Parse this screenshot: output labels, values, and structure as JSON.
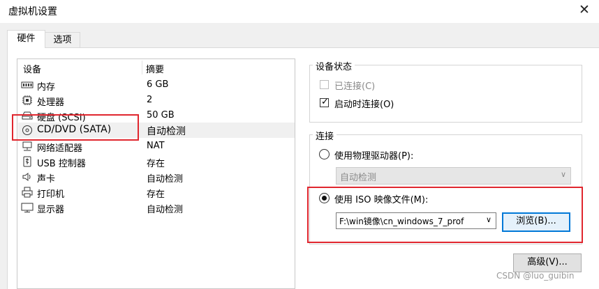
{
  "window": {
    "title": "虚拟机设置",
    "close_glyph": "✕"
  },
  "tabs": [
    {
      "label": "硬件"
    },
    {
      "label": "选项"
    }
  ],
  "device_list": {
    "col_device": "设备",
    "col_summary": "摘要",
    "rows": [
      {
        "name": "内存",
        "summary": "6 GB",
        "icon": "memory-icon"
      },
      {
        "name": "处理器",
        "summary": "2",
        "icon": "processor-icon"
      },
      {
        "name": "硬盘 (SCSI)",
        "summary": "50 GB",
        "icon": "hard-disk-icon"
      },
      {
        "name": "CD/DVD (SATA)",
        "summary": "自动检测",
        "icon": "cd-dvd-icon",
        "selected": true
      },
      {
        "name": "网络适配器",
        "summary": "NAT",
        "icon": "network-adapter-icon"
      },
      {
        "name": "USB 控制器",
        "summary": "存在",
        "icon": "usb-icon"
      },
      {
        "name": "声卡",
        "summary": "自动检测",
        "icon": "speaker-icon"
      },
      {
        "name": "打印机",
        "summary": "存在",
        "icon": "printer-icon"
      },
      {
        "name": "显示器",
        "summary": "自动检测",
        "icon": "monitor-icon"
      }
    ]
  },
  "device_status": {
    "title": "设备状态",
    "connected": {
      "label": "已连接(C)",
      "checked": false,
      "disabled": true
    },
    "connect_at_power_on": {
      "label": "启动时连接(O)",
      "checked": true
    }
  },
  "connection": {
    "title": "连接",
    "physical_drive": {
      "label": "使用物理驱动器(P):",
      "selected": false,
      "value": "自动检测"
    },
    "iso_image": {
      "label": "使用 ISO 映像文件(M):",
      "selected": true,
      "path": "F:\\win镜像\\cn_windows_7_prof"
    },
    "browse_label": "浏览(B)...",
    "dropdown_glyph": "∨"
  },
  "advanced_label": "高级(V)...",
  "watermark": "CSDN @luo_guibin",
  "colors": {
    "highlight_red": "#e0262e",
    "focus_blue": "#0078d7"
  }
}
